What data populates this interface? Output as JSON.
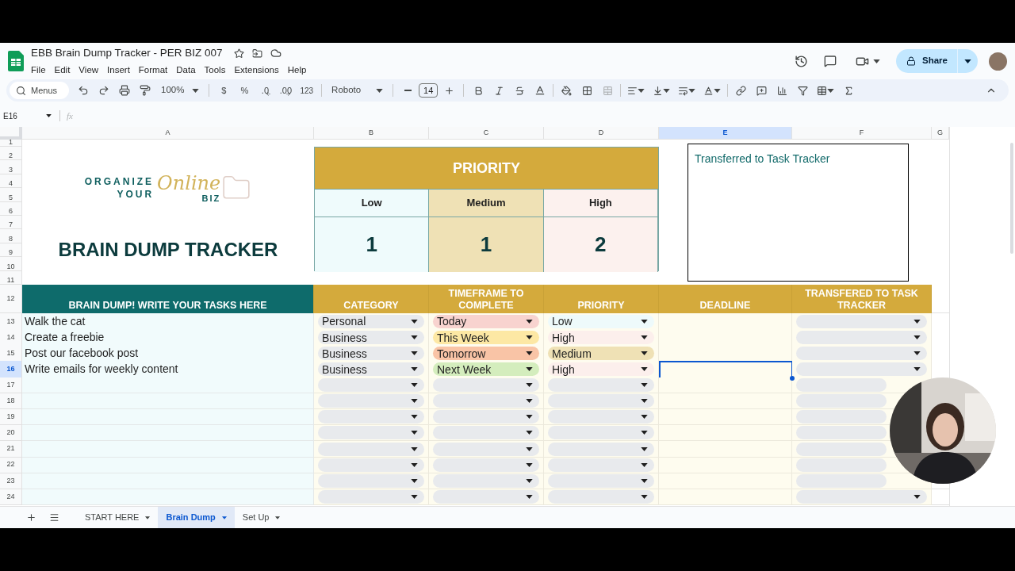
{
  "app": {
    "title": "EBB Brain Dump Tracker - PER BIZ 007",
    "menu": [
      "File",
      "Edit",
      "View",
      "Insert",
      "Format",
      "Data",
      "Tools",
      "Extensions",
      "Help"
    ],
    "share": "Share"
  },
  "toolbar": {
    "search_placeholder": "Menus",
    "zoom": "100%",
    "currency": "$",
    "percent": "%",
    "decrease_decimal": ".0",
    "increase_decimal": ".00",
    "number_format": "123",
    "font": "Roboto",
    "font_size": "14"
  },
  "formula_bar": {
    "cell_ref": "E16",
    "function_label": "fx"
  },
  "columns": [
    {
      "label": "A",
      "selected": false
    },
    {
      "label": "B",
      "selected": false
    },
    {
      "label": "C",
      "selected": false
    },
    {
      "label": "D",
      "selected": false
    },
    {
      "label": "E",
      "selected": true
    },
    {
      "label": "F",
      "selected": false
    },
    {
      "label": "G",
      "selected": false
    }
  ],
  "top_rows": [
    "1",
    "2",
    "3",
    "4",
    "5",
    "6",
    "7",
    "8",
    "9",
    "10",
    "11"
  ],
  "logo": {
    "line1": "ORGANIZE",
    "line2": "YOUR",
    "script": "Online",
    "suffix": "BIZ"
  },
  "title": "BRAIN DUMP TRACKER",
  "priority_summary": {
    "title": "PRIORITY",
    "levels": [
      {
        "label": "Low",
        "count": "1",
        "color": "#effbfc"
      },
      {
        "label": "Medium",
        "count": "1",
        "color": "#efe1b5"
      },
      {
        "label": "High",
        "count": "2",
        "color": "#fcf1ee"
      }
    ]
  },
  "note_box": {
    "text": "Transferred to Task Tracker"
  },
  "table": {
    "header_row": "12",
    "headers": [
      "BRAIN DUMP! WRITE YOUR TASKS HERE",
      "CATEGORY",
      "TIMEFRAME TO COMPLETE",
      "PRIORITY",
      "DEADLINE",
      "TRANSFERED TO TASK TRACKER"
    ],
    "rows": [
      {
        "number": "13",
        "selected": false,
        "task": "Walk the cat",
        "category": "Personal",
        "timeframe": {
          "value": "Today",
          "color": "#f8d3cf"
        },
        "priority": {
          "value": "Low",
          "color": "#eefafb"
        }
      },
      {
        "number": "14",
        "selected": false,
        "task": "Create a freebie",
        "category": "Business",
        "timeframe": {
          "value": "This Week",
          "color": "#fde8a4"
        },
        "priority": {
          "value": "High",
          "color": "#fcefec"
        }
      },
      {
        "number": "15",
        "selected": false,
        "task": "Post our facebook post",
        "category": "Business",
        "timeframe": {
          "value": "Tomorrow",
          "color": "#f9c4a6"
        },
        "priority": {
          "value": "Medium",
          "color": "#efe1b5"
        }
      },
      {
        "number": "16",
        "selected": true,
        "task": "Write emails for weekly content",
        "category": "Business",
        "timeframe": {
          "value": "Next Week",
          "color": "#d4edbd"
        },
        "priority": {
          "value": "High",
          "color": "#fcefec"
        }
      },
      {
        "number": "17",
        "selected": false
      },
      {
        "number": "18",
        "selected": false
      },
      {
        "number": "19",
        "selected": false
      },
      {
        "number": "20",
        "selected": false
      },
      {
        "number": "21",
        "selected": false
      },
      {
        "number": "22",
        "selected": false
      },
      {
        "number": "23",
        "selected": false
      },
      {
        "number": "24",
        "selected": false
      }
    ]
  },
  "sheet_tabs": [
    {
      "label": "START HERE",
      "selected": false
    },
    {
      "label": "Brain Dump",
      "selected": true
    },
    {
      "label": "Set Up",
      "selected": false
    }
  ]
}
